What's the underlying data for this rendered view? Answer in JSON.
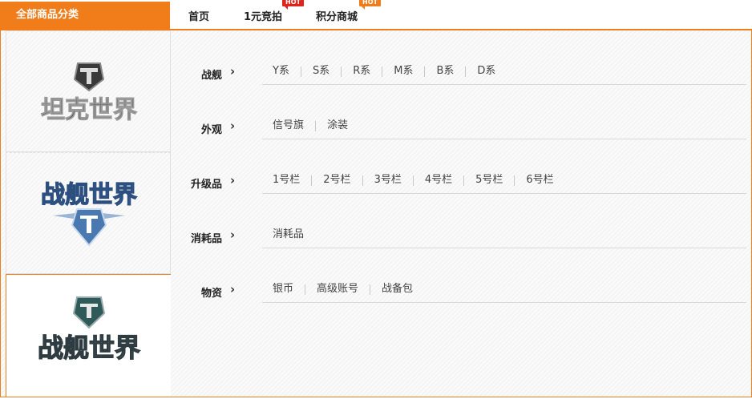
{
  "header": {
    "all_categories": "全部商品分类",
    "nav": [
      {
        "label": "首页",
        "badge": ""
      },
      {
        "label": "1元竞拍",
        "badge": "HOT"
      },
      {
        "label": "积分商城",
        "badge": "HOT"
      }
    ]
  },
  "games": [
    {
      "name": "坦克世界"
    },
    {
      "name": "战舰世界"
    },
    {
      "name": "战舰世界"
    }
  ],
  "categories": [
    {
      "label": "战舰",
      "items": [
        "Y系",
        "S系",
        "R系",
        "M系",
        "B系",
        "D系"
      ]
    },
    {
      "label": "外观",
      "items": [
        "信号旗",
        "涂装"
      ]
    },
    {
      "label": "升级品",
      "items": [
        "1号栏",
        "2号栏",
        "3号栏",
        "4号栏",
        "5号栏",
        "6号栏"
      ]
    },
    {
      "label": "消耗品",
      "items": [
        "消耗品"
      ]
    },
    {
      "label": "物资",
      "items": [
        "银币",
        "高级账号",
        "战备包"
      ]
    }
  ],
  "colors": {
    "accent": "#f07d1a",
    "hot_red": "#e2231a",
    "hot_orange": "#f07d1a"
  }
}
